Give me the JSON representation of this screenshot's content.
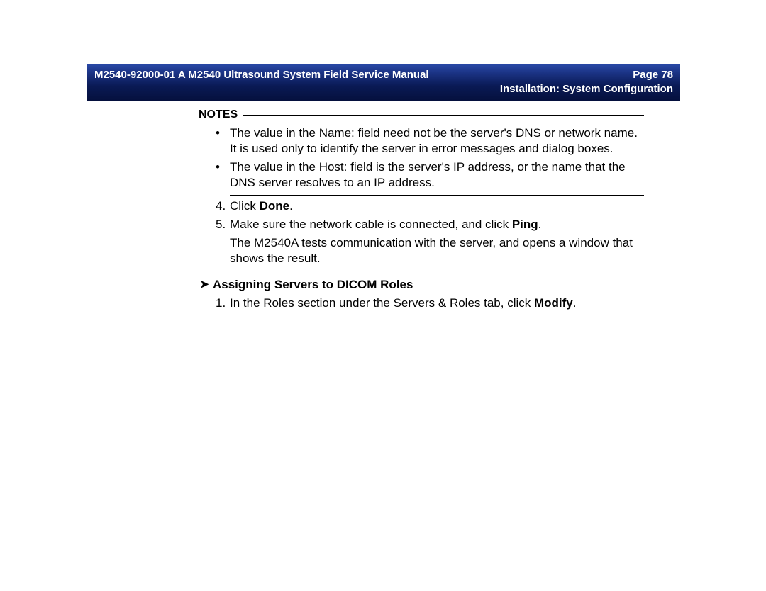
{
  "banner": {
    "doc_title": "M2540-92000-01 A M2540 Ultrasound System Field Service Manual",
    "page_label": "Page 78",
    "section": "Installation: System Configuration"
  },
  "notes": {
    "heading": "NOTES",
    "items": [
      "The value in the Name: field need not be the server's DNS or network name. It is used only to identify the server in error messages and dialog boxes.",
      "The value in the Host: field is the server's IP address, or the name that the DNS server resolves to an IP address."
    ]
  },
  "steps": {
    "four": {
      "marker": "4.",
      "pre": "Click ",
      "bold": "Done",
      "post": "."
    },
    "five": {
      "marker": "5.",
      "pre": "Make sure the network cable is connected, and click ",
      "bold": "Ping",
      "post": "."
    },
    "five_cont": "The M2540A tests communication with the server, and opens a window that shows the result."
  },
  "subsection": {
    "arrow": "➤",
    "title": "Assigning Servers to DICOM Roles",
    "step1": {
      "marker": "1.",
      "pre": "In the Roles section under the Servers & Roles tab, click ",
      "bold": "Modify",
      "post": "."
    }
  }
}
